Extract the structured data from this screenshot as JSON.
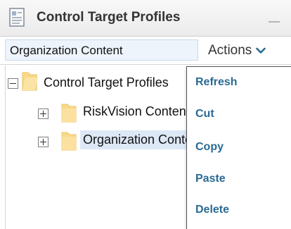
{
  "window": {
    "title": "Control Target Profiles",
    "title_icon": "document-icon",
    "minimize_icon": "minimize-icon"
  },
  "toolbar": {
    "breadcrumb": "Organization Content",
    "actions_label": "Actions",
    "actions_icon": "chevron-down-icon"
  },
  "tree": {
    "root": {
      "label": "Control Target Profiles",
      "expanded": true
    },
    "children": [
      {
        "label": "RiskVision Content",
        "expanded": false,
        "selected": false
      },
      {
        "label": "Organization Content",
        "expanded": false,
        "selected": true
      }
    ]
  },
  "actions_menu": {
    "items": [
      "Refresh",
      "Cut",
      "Copy",
      "Paste",
      "Delete"
    ]
  },
  "colors": {
    "menu_text": "#2a6a93",
    "selection": "#dde8f6",
    "folder": "#f8d98a",
    "chevron": "#2a6a93"
  }
}
